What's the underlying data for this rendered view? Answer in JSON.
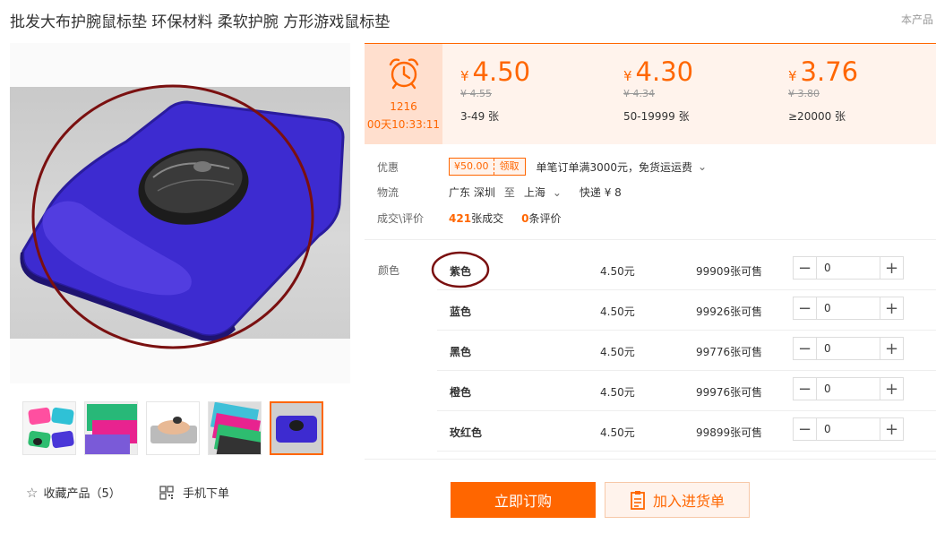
{
  "product": {
    "title": "批发大布护腕鼠标垫 环保材料 柔软护腕 方形游戏鼠标垫",
    "title_right": "本产品"
  },
  "gallery": {
    "thumbnails": [
      "pink-blue-green-purple-pads",
      "green-pink-purple-pads",
      "hand-on-wrist-rest",
      "stacked-colored-pads",
      "purple-pad-with-mouse"
    ],
    "favorite_label": "收藏产品（5）",
    "mobile_label": "手机下单"
  },
  "price": {
    "countdown_date": "1216",
    "countdown_time": "00天10:33:11",
    "currency": "¥",
    "tiers": [
      {
        "price": "4.50",
        "original": "¥ 4.55",
        "range": "3-49 张"
      },
      {
        "price": "4.30",
        "original": "¥ 4.34",
        "range": "50-19999 张"
      },
      {
        "price": "3.76",
        "original": "¥ 3.80",
        "range": "≥20000 张"
      }
    ]
  },
  "info": {
    "discount_label": "优惠",
    "coupon_amount": "¥50.00",
    "coupon_get": "领取",
    "discount_text": "单笔订单满3000元，免货运运费",
    "logistics_label": "物流",
    "from": "广东 深圳",
    "to_word": "至",
    "to": "上海",
    "shipping": "快递 ¥ 8",
    "deals_label": "成交\\评价",
    "deals_count": "421",
    "deals_unit": "张成交",
    "reviews_count": "0",
    "reviews_unit": "条评价"
  },
  "sku": {
    "label": "颜色",
    "rows": [
      {
        "name": "紫色",
        "price": "4.50元",
        "stock": "99909张可售",
        "qty": "0"
      },
      {
        "name": "蓝色",
        "price": "4.50元",
        "stock": "99926张可售",
        "qty": "0"
      },
      {
        "name": "黑色",
        "price": "4.50元",
        "stock": "99776张可售",
        "qty": "0"
      },
      {
        "name": "橙色",
        "price": "4.50元",
        "stock": "99976张可售",
        "qty": "0"
      },
      {
        "name": "玫红色",
        "price": "4.50元",
        "stock": "99899张可售",
        "qty": "0"
      }
    ]
  },
  "actions": {
    "buy_label": "立即订购",
    "cart_label": "加入进货单"
  },
  "colors": {
    "accent": "#ff6600",
    "price_bg": "#fff3ec",
    "countdown_bg": "#ffdfce",
    "annotation_circle": "#7a1010"
  }
}
